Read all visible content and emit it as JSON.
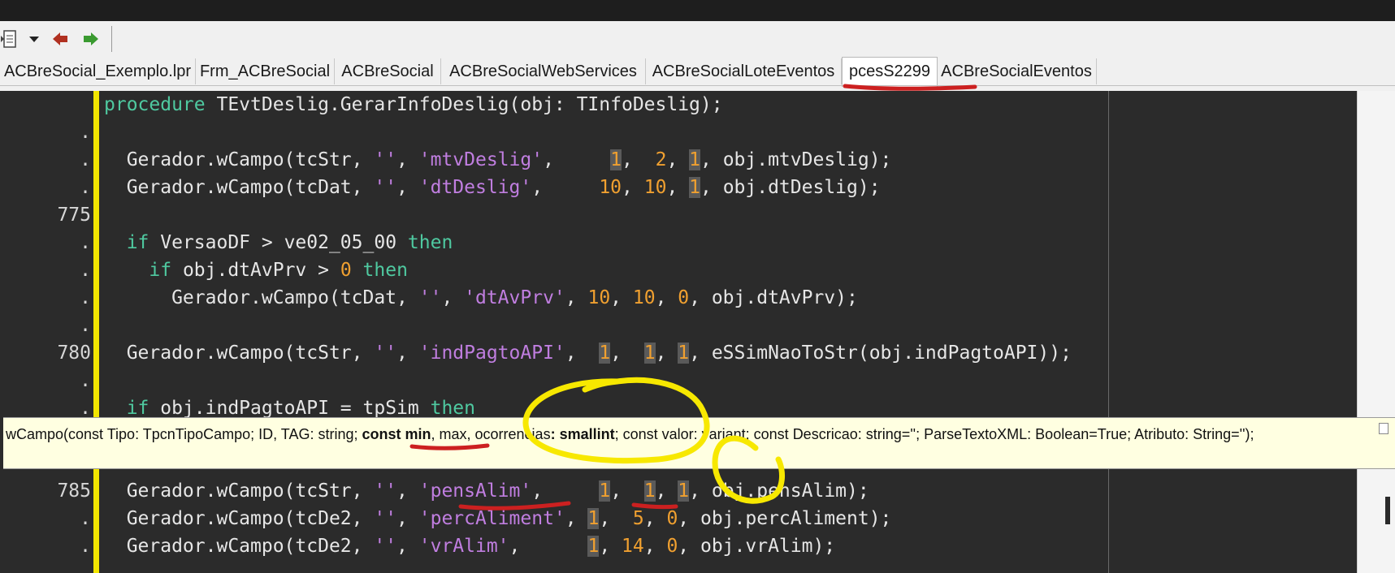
{
  "toolbar": {
    "icons": [
      "list-icon",
      "dropdown-arrow-icon",
      "back-arrow-icon",
      "forward-arrow-icon"
    ],
    "colors": {
      "back": "#b03020",
      "forward": "#3a9a30"
    }
  },
  "tabs": [
    {
      "label": "ACBreSocial_Exemplo.lpr"
    },
    {
      "label": "Frm_ACBreSocial"
    },
    {
      "label": "ACBreSocial"
    },
    {
      "label": "ACBreSocialWebServices"
    },
    {
      "label": "ACBreSocialLoteEventos"
    },
    {
      "label": "pcesS2299",
      "active": true
    },
    {
      "label": "ACBreSocialEventos"
    }
  ],
  "gutter": {
    "line_775": "775",
    "line_780": "780",
    "line_785": "785",
    "dot": "."
  },
  "code": {
    "l1": {
      "kw": "procedure",
      "rest": " TEvtDeslig.GerarInfoDeslig(obj: TInfoDeslig);"
    },
    "l3": {
      "a": "  Gerador.wCampo(tcStr, ",
      "s1": "''",
      "b": ", ",
      "s2": "'mtvDeslig'",
      "c": ",     ",
      "n1": "1",
      "d": ",  ",
      "n2": "2",
      "e": ", ",
      "n3": "1",
      "f": ", obj.mtvDeslig);"
    },
    "l4": {
      "a": "  Gerador.wCampo(tcDat, ",
      "s1": "''",
      "b": ", ",
      "s2": "'dtDeslig'",
      "c": ",     ",
      "n1": "10",
      "d": ", ",
      "n2": "10",
      "e": ", ",
      "n3": "1",
      "f": ", obj.dtDeslig);"
    },
    "l6": {
      "a": "  ",
      "kw1": "if",
      "b": " VersaoDF > ve02_05_00 ",
      "kw2": "then"
    },
    "l7": {
      "a": "    ",
      "kw1": "if",
      "b": " obj.dtAvPrv > ",
      "n1": "0",
      "c": " ",
      "kw2": "then"
    },
    "l8": {
      "a": "      Gerador.wCampo(tcDat, ",
      "s1": "''",
      "b": ", ",
      "s2": "'dtAvPrv'",
      "c": ", ",
      "n1": "10",
      "d": ", ",
      "n2": "10",
      "e": ", ",
      "n3": "0",
      "f": ", obj.dtAvPrv);"
    },
    "l10": {
      "a": "  Gerador.wCampo(tcStr, ",
      "s1": "''",
      "b": ", ",
      "s2": "'indPagtoAPI'",
      "c": ",  ",
      "n1": "1",
      "d": ",  ",
      "n2": "1",
      "e": ", ",
      "n3": "1",
      "f": ", eSSimNaoToStr(obj.indPagtoAPI));"
    },
    "l12": {
      "a": "  ",
      "kw1": "if",
      "b": " obj.indPagtoAPI = tpSim ",
      "kw2": "then"
    },
    "l14": {
      "a": "  Gerador.wCampo(tcStr, ",
      "s1": "''",
      "b": ", ",
      "s2": "'pensAlim'",
      "c": ",     ",
      "n1": "1",
      "d": ",  ",
      "n2": "1",
      "e": ", ",
      "n3": "1",
      "f": ", obj.pensAlim);"
    },
    "l15": {
      "a": "  Gerador.wCampo(tcDe2, ",
      "s1": "''",
      "b": ", ",
      "s2": "'percAliment'",
      "c": ", ",
      "n1": "1",
      "d": ",  ",
      "n2": "5",
      "e": ", ",
      "n3": "0",
      "f": ", obj.percAliment);"
    },
    "l16": {
      "a": "  Gerador.wCampo(tcDe2, ",
      "s1": "''",
      "b": ", ",
      "s2": "'vrAlim'",
      "c": ",      ",
      "n1": "1",
      "d": ", ",
      "n2": "14",
      "e": ", ",
      "n3": "0",
      "f": ", obj.vrAlim);"
    }
  },
  "tooltip": {
    "p1": "wCampo(const Tipo: TpcnTipoCampo; ID, TAG: string; ",
    "b1": "const min",
    "p2": ", max, ocorrencias",
    "b2": ": smallint",
    "p3": "; const valor: variant; const Descricao: string=''; ParseTextoXML: Boolean=True; Atributo: String='');"
  },
  "colors": {
    "editor_bg": "#2b2b2b",
    "keyword": "#4fc9a0",
    "string": "#c07ee0",
    "number": "#f0a030",
    "gutter_edge": "#f2e600",
    "annotation_red": "#cc2020",
    "annotation_yellow": "#f7e800"
  }
}
